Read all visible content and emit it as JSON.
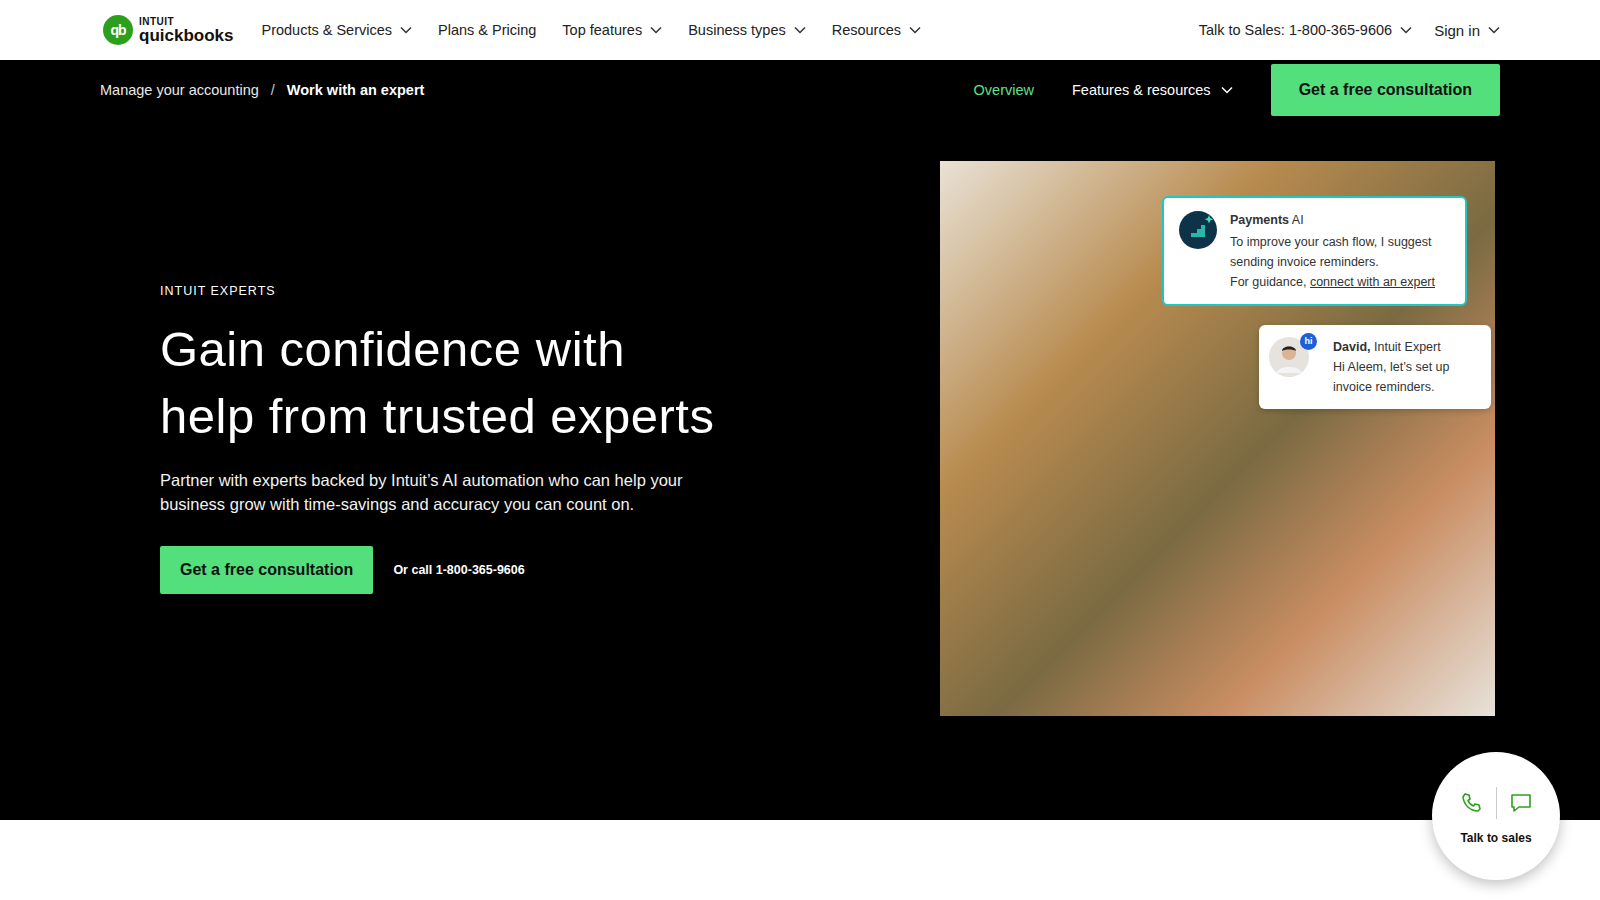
{
  "header": {
    "logo": {
      "mark": "qb",
      "top": "INTUIT",
      "name": "quickbooks"
    },
    "nav": [
      {
        "label": "Products & Services",
        "dropdown": true
      },
      {
        "label": "Plans & Pricing",
        "dropdown": false
      },
      {
        "label": "Top features",
        "dropdown": true
      },
      {
        "label": "Business types",
        "dropdown": true
      },
      {
        "label": "Resources",
        "dropdown": true
      }
    ],
    "sales": {
      "label": "Talk to Sales: 1-800-365-9606",
      "dropdown": true
    },
    "sign_in": {
      "label": "Sign in",
      "dropdown": true
    }
  },
  "subnav": {
    "breadcrumbs": [
      {
        "label": "Manage your accounting",
        "current": false
      },
      {
        "label": "Work with an expert",
        "current": true
      }
    ],
    "separator": "/",
    "links": [
      {
        "label": "Overview",
        "selected": true,
        "dropdown": false
      },
      {
        "label": "Features & resources",
        "selected": false,
        "dropdown": true
      }
    ],
    "cta": "Get a free consultation"
  },
  "hero": {
    "eyebrow": "INTUIT EXPERTS",
    "title": "Gain confidence with help from trusted experts",
    "body": "Partner with experts backed by Intuit’s AI automation who can help your business grow with time-savings and accuracy you can count on.",
    "cta": "Get a free consultation",
    "call": "Or call 1-800-365-9606"
  },
  "image_cards": {
    "assistant": {
      "title": "Payments",
      "tag": "AI",
      "text": "To improve your cash flow, I suggest sending invoice reminders.",
      "guidance": "For guidance,",
      "link": "connect with an expert"
    },
    "chat": {
      "name": "David,",
      "role": "Intuit Expert",
      "badge": "hi",
      "message": "Hi Aleem, let’s set up invoice reminders."
    }
  },
  "floating": {
    "label": "Talk to sales"
  }
}
